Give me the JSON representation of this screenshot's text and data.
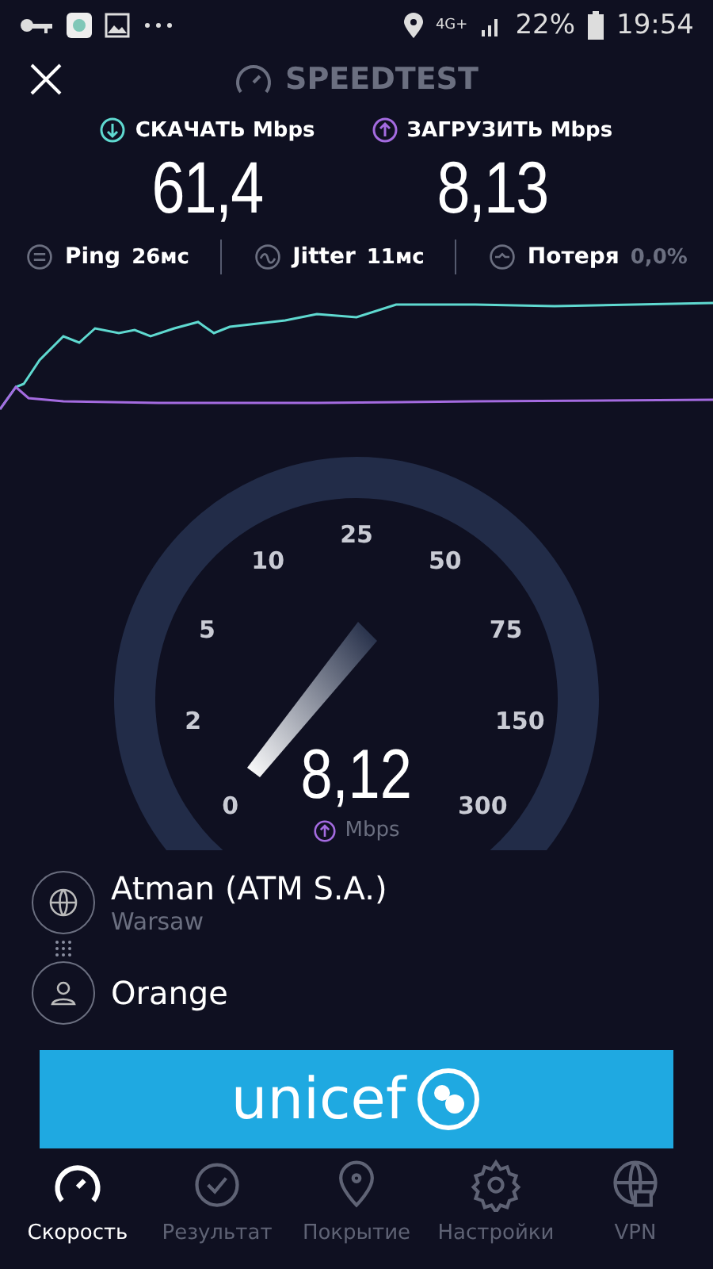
{
  "status_bar": {
    "network": "4G+",
    "battery": "22%",
    "time": "19:54"
  },
  "header": {
    "title": "SPEEDTEST"
  },
  "results": [
    {
      "kind": "download",
      "label": "СКАЧАТЬ Mbps",
      "value": "61,4"
    },
    {
      "kind": "upload",
      "label": "ЗАГРУЗИТЬ Mbps",
      "value": "8,13"
    }
  ],
  "stats": [
    {
      "kind": "ping",
      "label": "Ping",
      "value": "26мс"
    },
    {
      "kind": "jitter",
      "label": "Jitter",
      "value": "11мс"
    },
    {
      "kind": "loss",
      "label": "Потеря",
      "value": "0,0%"
    }
  ],
  "gauge": {
    "ticks": [
      "0",
      "2",
      "5",
      "10",
      "25",
      "50",
      "75",
      "150",
      "300"
    ],
    "value": "8,12",
    "unit": "Mbps"
  },
  "server": {
    "name": "Atman (ATM S.A.)",
    "location": "Warsaw"
  },
  "provider": {
    "name": "Orange"
  },
  "banner": {
    "text": "unicef"
  },
  "nav": [
    {
      "label": "Скорость",
      "kind": "speed",
      "selected": true
    },
    {
      "label": "Результат",
      "kind": "results",
      "selected": false
    },
    {
      "label": "Покрытие",
      "kind": "coverage",
      "selected": false
    },
    {
      "label": "Настройки",
      "kind": "settings",
      "selected": false
    },
    {
      "label": "VPN",
      "kind": "vpn",
      "selected": false
    }
  ]
}
